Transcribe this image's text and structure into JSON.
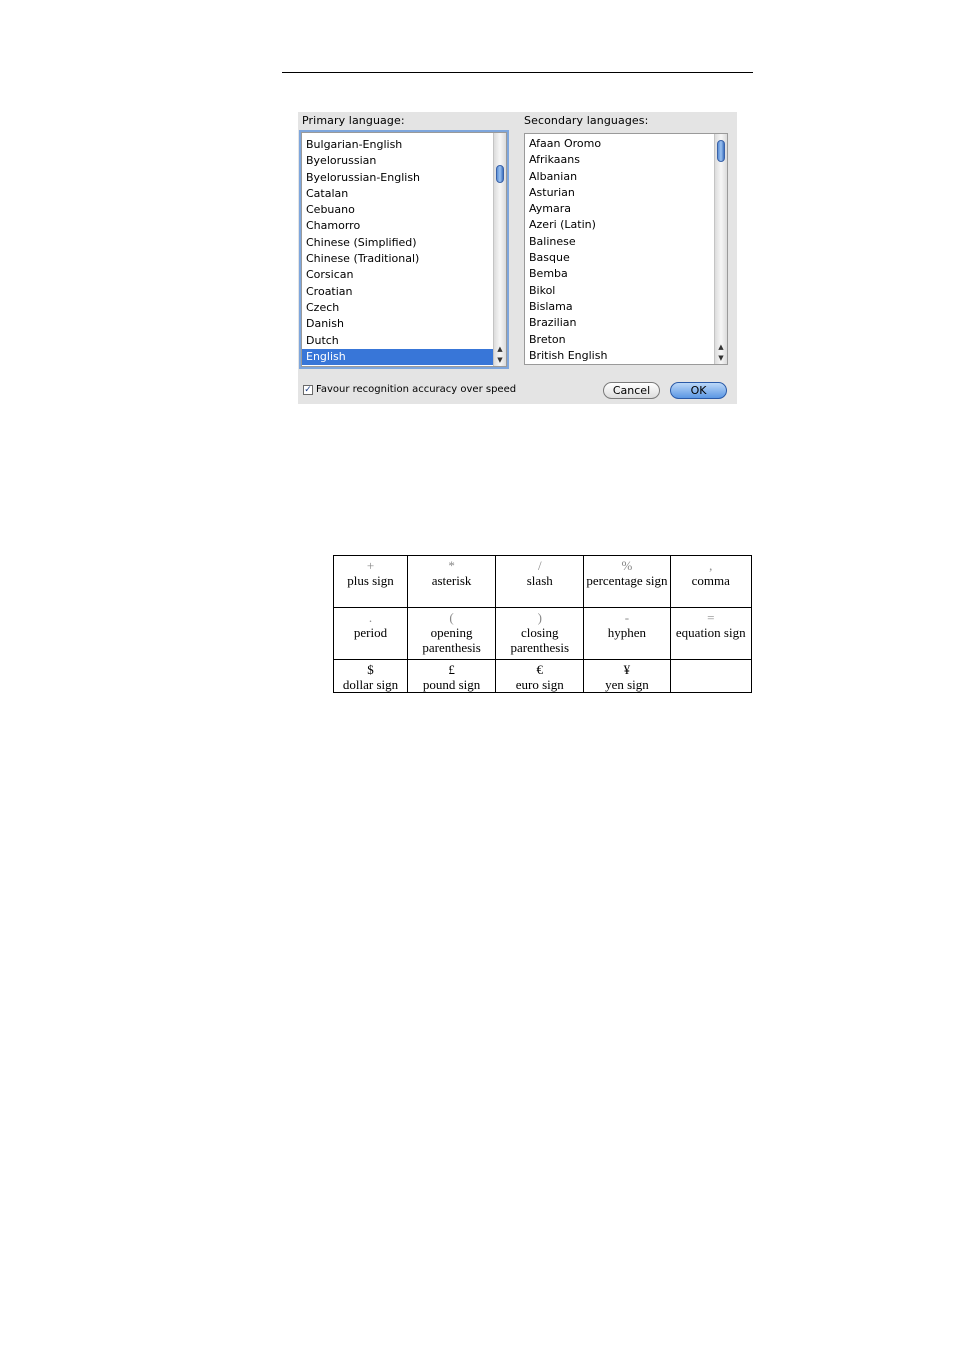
{
  "dialog": {
    "primary_label": "Primary language:",
    "secondary_label": "Secondary languages:",
    "primary_languages": [
      "Bulgarian-English",
      "Byelorussian",
      "Byelorussian-English",
      "Catalan",
      "Cebuano",
      "Chamorro",
      "Chinese (Simplified)",
      "Chinese (Traditional)",
      "Corsican",
      "Croatian",
      "Czech",
      "Danish",
      "Dutch",
      "English"
    ],
    "primary_selected": "English",
    "secondary_languages": [
      "Afaan Oromo",
      "Afrikaans",
      "Albanian",
      "Asturian",
      "Aymara",
      "Azeri (Latin)",
      "Balinese",
      "Basque",
      "Bemba",
      "Bikol",
      "Bislama",
      "Brazilian",
      "Breton",
      "British English"
    ],
    "checkbox_label": "Favour recognition accuracy over speed",
    "checkbox_checked": true,
    "cancel_label": "Cancel",
    "ok_label": "OK",
    "scroll_up_icon": "▲",
    "scroll_down_icon": "▼",
    "check_icon": "✓"
  },
  "symbols_table": {
    "rows": [
      [
        {
          "symbol": "+",
          "name": "plus sign"
        },
        {
          "symbol": "*",
          "name": "asterisk"
        },
        {
          "symbol": "/",
          "name": "slash"
        },
        {
          "symbol": "%",
          "name": "percentage sign"
        },
        {
          "symbol": ",",
          "name": "comma"
        }
      ],
      [
        {
          "symbol": ".",
          "name": "period"
        },
        {
          "symbol": "(",
          "name": "opening parenthesis"
        },
        {
          "symbol": ")",
          "name": "closing parenthesis"
        },
        {
          "symbol": "-",
          "name": "hyphen"
        },
        {
          "symbol": "=",
          "name": "equation sign"
        }
      ],
      [
        {
          "symbol": "$",
          "name": "dollar sign"
        },
        {
          "symbol": "£",
          "name": "pound sign"
        },
        {
          "symbol": "€",
          "name": "euro sign"
        },
        {
          "symbol": "¥",
          "name": "yen sign"
        },
        {
          "symbol": "",
          "name": ""
        }
      ]
    ]
  }
}
